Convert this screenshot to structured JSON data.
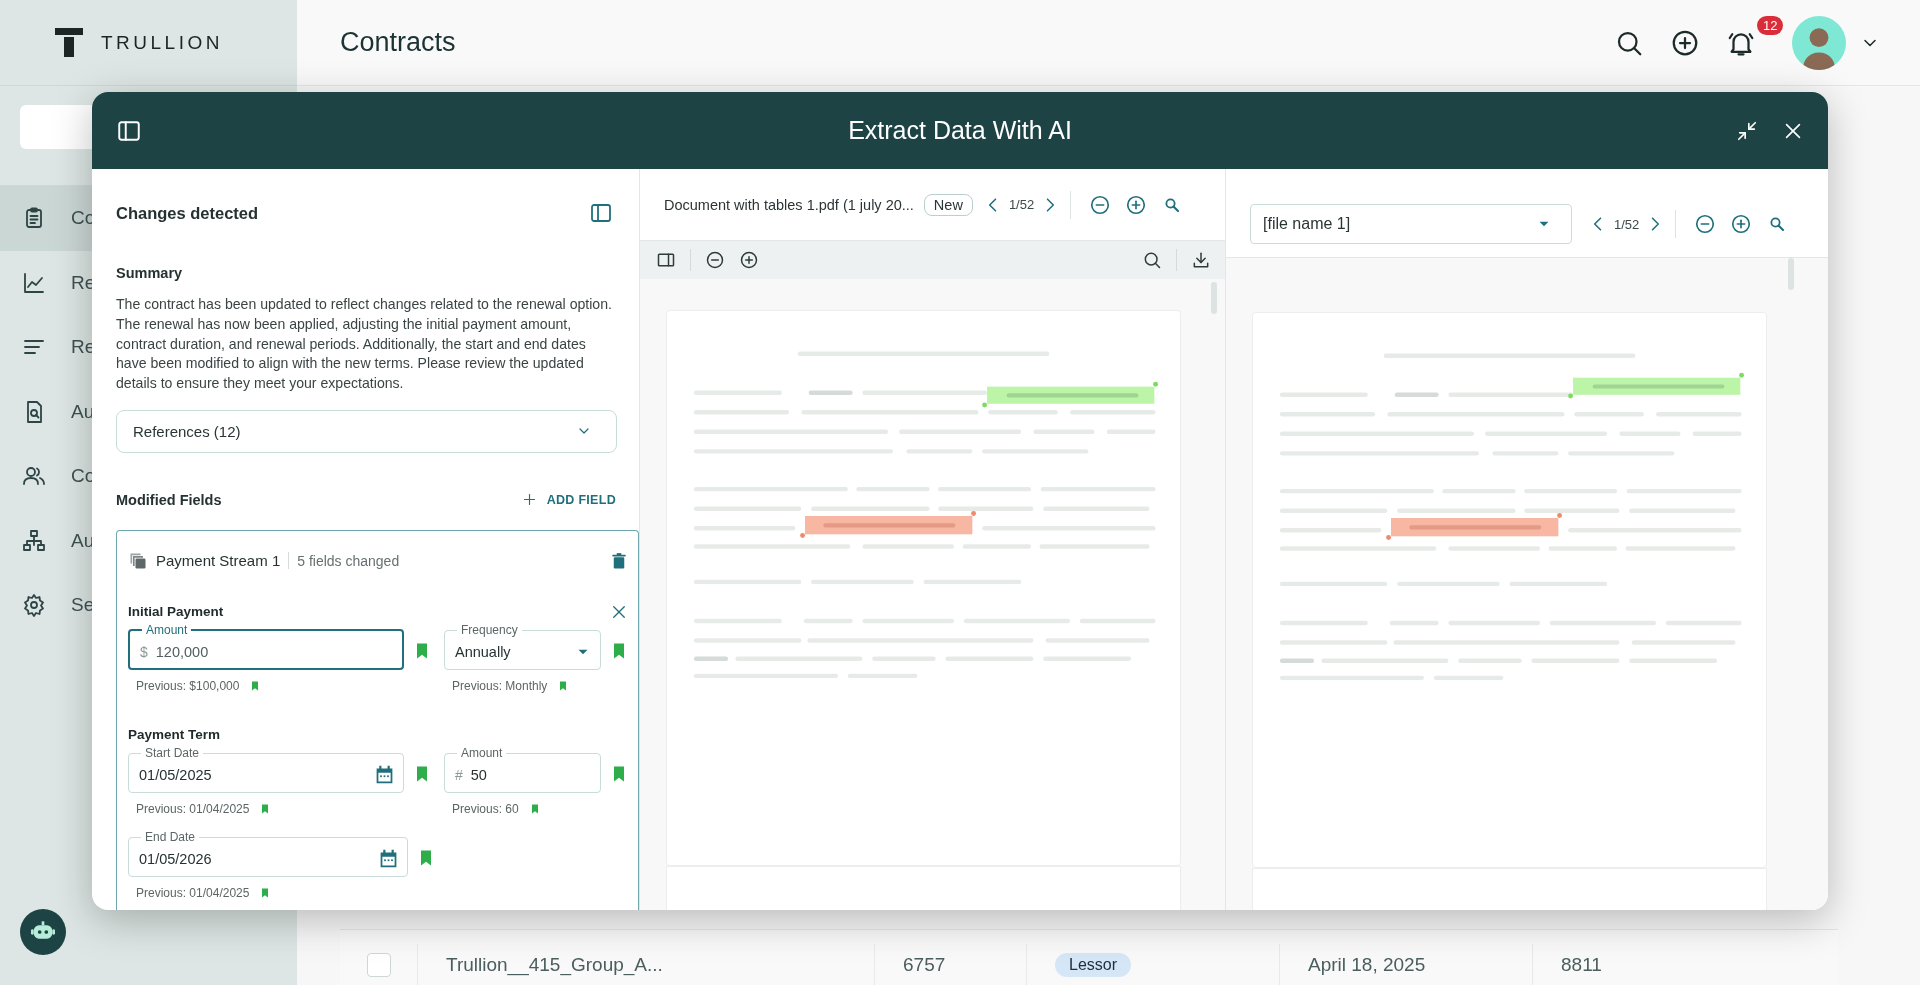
{
  "app": {
    "logo": "TRULLION",
    "page_title": "Contracts",
    "notification_count": "12",
    "sidebar": {
      "items": [
        {
          "label": "Co",
          "selected": true
        },
        {
          "label": "Re",
          "selected": false
        },
        {
          "label": "Re",
          "selected": false
        },
        {
          "label": "Au",
          "selected": false
        },
        {
          "label": "Co",
          "selected": false
        },
        {
          "label": "Au",
          "selected": false
        },
        {
          "label": "Se",
          "selected": false
        }
      ]
    },
    "table": {
      "rows": [
        {
          "checked": false,
          "cells": [
            {
              "kind": "text",
              "text": "Trullion__415_Group_A..."
            },
            {
              "kind": "text",
              "text": "6757"
            },
            {
              "kind": "tag",
              "text": "Lessor"
            },
            {
              "kind": "text",
              "text": "April 18, 2025"
            },
            {
              "kind": "text",
              "text": "8811"
            }
          ]
        }
      ]
    }
  },
  "modal": {
    "title": "Extract Data With AI",
    "changes": {
      "title": "Changes detected",
      "summary_heading": "Summary",
      "summary": "The contract has been updated to reflect changes related to the renewal option. The renewal has now been applied, adjusting the initial payment amount, contract duration, and renewal periods. Additionally, the start and end dates have been modified to align with the new terms. Please review the updated details to ensure they meet your expectations.",
      "references": "References (12)",
      "modified_heading": "Modified Fields",
      "add_field": "ADD FIELD",
      "streams": [
        {
          "name": "Payment Stream 1",
          "count": "5 fields changed",
          "groups": [
            {
              "title": "Initial Payment",
              "closable": true,
              "fields": [
                {
                  "label": "Amount",
                  "kind": "text",
                  "prefix": "$",
                  "value": "120,000",
                  "focused": true,
                  "previous": "Previous: $100,000"
                },
                {
                  "label": "Frequency",
                  "kind": "select",
                  "value": "Annually",
                  "focused": false,
                  "previous": "Previous: Monthly"
                }
              ]
            },
            {
              "title": "Payment Term",
              "closable": false,
              "fields": [
                {
                  "label": "Start Date",
                  "kind": "date",
                  "value": "01/05/2025",
                  "focused": false,
                  "previous": "Previous: 01/04/2025"
                },
                {
                  "label": "Amount",
                  "kind": "text",
                  "prefix": "#",
                  "value": "50",
                  "focused": false,
                  "previous": "Previous: 60"
                },
                {
                  "label": "End Date",
                  "kind": "date",
                  "value": "01/05/2026",
                  "focused": false,
                  "previous": "Previous: 01/04/2025"
                }
              ]
            }
          ]
        }
      ]
    },
    "viewer_left": {
      "file": "Document with tables 1.pdf (1 july 20...",
      "badge": "New",
      "page": "1/52"
    },
    "viewer_right": {
      "file": "[file name 1]",
      "page": "1/52"
    }
  }
}
